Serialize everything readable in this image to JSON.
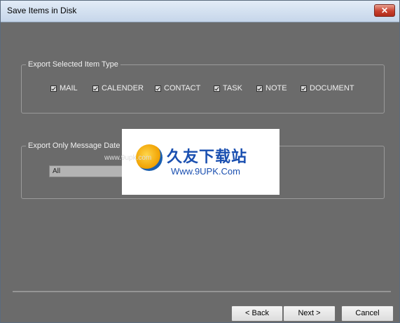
{
  "window": {
    "title": "Save Items in Disk",
    "close_label": "✕"
  },
  "export_item_type": {
    "legend": "Export Selected Item Type",
    "items": [
      {
        "label": "MAIL",
        "checked": true
      },
      {
        "label": "CALENDER",
        "checked": true
      },
      {
        "label": "CONTACT",
        "checked": true
      },
      {
        "label": "TASK",
        "checked": true
      },
      {
        "label": "NOTE",
        "checked": true
      },
      {
        "label": "DOCUMENT",
        "checked": true
      }
    ]
  },
  "export_date": {
    "legend": "Export Only Message Date",
    "selected": "All"
  },
  "watermark": {
    "cn_text": "久友下载站",
    "url": "Www.9UPK.Com",
    "small": "www.9upk.com"
  },
  "buttons": {
    "back": "< Back",
    "next": "Next >",
    "cancel": "Cancel"
  },
  "colors": {
    "window_bg": "#6b6b6b",
    "title_bg": "#d3e0ef",
    "close_red": "#c8402e",
    "watermark_blue": "#1a4fb0"
  }
}
